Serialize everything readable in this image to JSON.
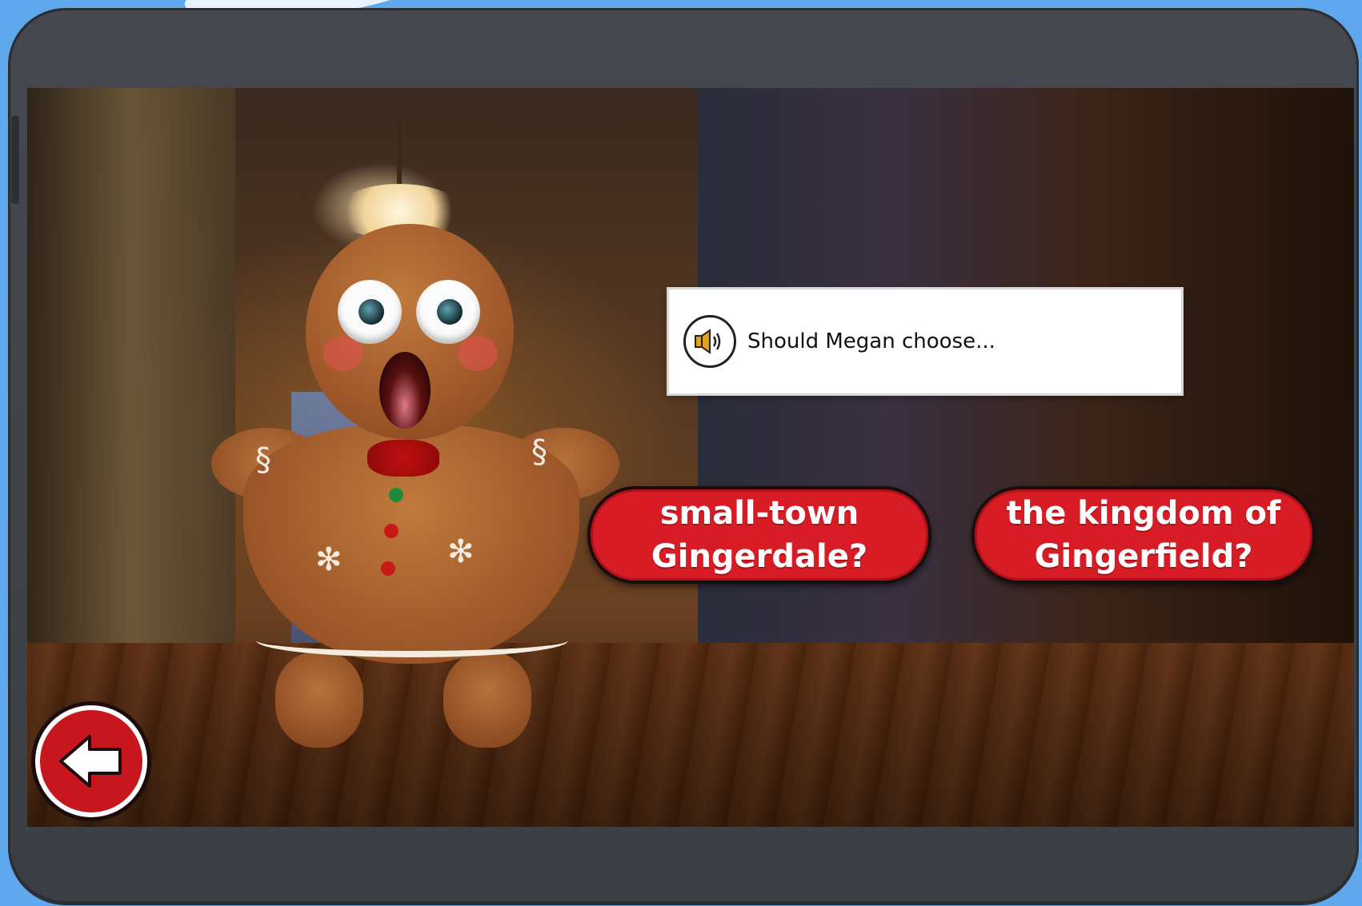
{
  "prompt": {
    "text": "Should Megan choose...",
    "speaker_icon": "speaker-icon"
  },
  "choices": [
    {
      "label": "small-town Gingerdale?"
    },
    {
      "label": "the kingdom of Gingerfield?"
    }
  ],
  "back_button": {
    "icon": "arrow-left-icon"
  },
  "colors": {
    "background": "#5fa8ee",
    "tablet_frame": "#3f4247",
    "choice_red": "#d81c25",
    "back_red": "#c8161f"
  }
}
